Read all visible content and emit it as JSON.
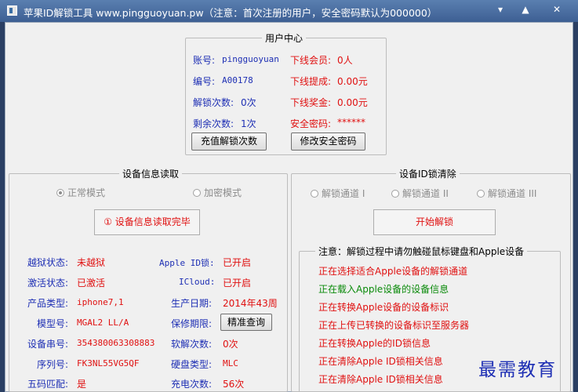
{
  "window": {
    "title": "苹果ID解锁工具 www.pingguoyuan.pw（注意：首次注册的用户，安全密码默认为000000）",
    "controls": {
      "minimize": "▾",
      "maximize": "▲",
      "close": "✕"
    }
  },
  "user_center": {
    "title": "用户中心",
    "account_label": "账号:",
    "account_value": "pingguoyuan",
    "member_label": "下线会员:",
    "member_value": "0人",
    "id_label": "编号:",
    "id_value": "A00178",
    "commission_label": "下线提成:",
    "commission_value": "0.00元",
    "unlock_count_label": "解锁次数:",
    "unlock_count_value": "0次",
    "bonus_label": "下线奖金:",
    "bonus_value": "0.00元",
    "remaining_label": "剩余次数:",
    "remaining_value": "1次",
    "password_label": "安全密码:",
    "password_value": "******",
    "recharge_button": "充值解锁次数",
    "change_password_button": "修改安全密码"
  },
  "device_info": {
    "title": "设备信息读取",
    "mode_normal": "正常模式",
    "mode_encrypted": "加密模式",
    "status_button": "① 设备信息读取完毕",
    "rows": [
      {
        "label": "越狱状态:",
        "value": "未越狱",
        "label2": "Apple ID锁:",
        "value2": "已开启"
      },
      {
        "label": "激活状态:",
        "value": "已激活",
        "label2": "ICloud:",
        "value2": "已开启"
      },
      {
        "label": "产品类型:",
        "value": "iphone7,1",
        "label2": "生产日期:",
        "value2": "2014年43周"
      },
      {
        "label": "模型号:",
        "value": "MGAL2 LL/A",
        "label2": "保修期限:",
        "value2": ""
      },
      {
        "label": "设备串号:",
        "value": "354380063308883",
        "label2": "软解次数:",
        "value2": "0次"
      },
      {
        "label": "序列号:",
        "value": "FK3NL55VG5QF",
        "label2": "硬盘类型:",
        "value2": "MLC"
      },
      {
        "label": "五码匹配:",
        "value": "是",
        "label2": "充电次数:",
        "value2": "56次"
      }
    ],
    "warranty_button": "精准查询"
  },
  "id_clear": {
    "title": "设备ID锁清除",
    "channel_1": "解锁通道 I",
    "channel_2": "解锁通道 II",
    "channel_3": "解锁通道 III",
    "start_button": "开始解锁",
    "notice_title": "注意：解锁过程中请勿触碰鼠标键盘和Apple设备",
    "log": [
      {
        "text": "正在选择适合Apple设备的解锁通道",
        "color": "#e01010"
      },
      {
        "text": "正在载入Apple设备的设备信息",
        "color": "#0a8a0a"
      },
      {
        "text": "正在转换Apple设备的设备标识",
        "color": "#e01010"
      },
      {
        "text": "正在上传已转换的设备标识至服务器",
        "color": "#e01010"
      },
      {
        "text": "正在转换Apple的ID锁信息",
        "color": "#e01010"
      },
      {
        "text": "正在清除Apple ID锁相关信息",
        "color": "#e01010"
      },
      {
        "text": "正在清除Apple ID锁相关信息",
        "color": "#e01010"
      },
      {
        "text": "Apple ID锁清除完毕,请重启Apple并重新设置Apple ID",
        "color": "#e01010"
      }
    ]
  },
  "watermark": "最需教育"
}
